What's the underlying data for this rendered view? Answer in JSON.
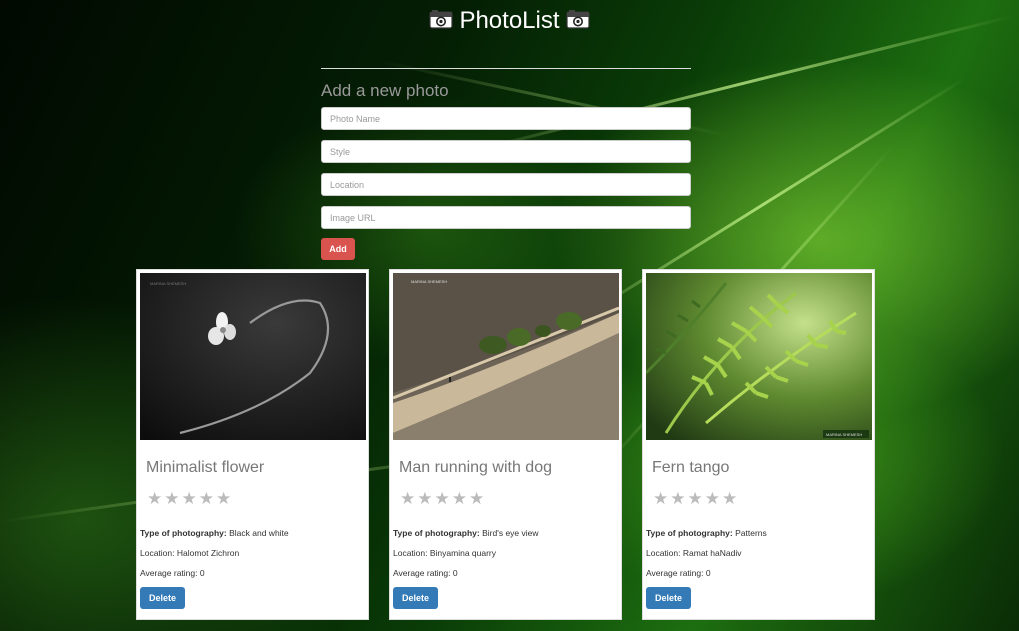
{
  "header": {
    "title": "PhotoList",
    "icon": "camera-icon"
  },
  "form": {
    "heading": "Add a new photo",
    "name_placeholder": "Photo Name",
    "style_placeholder": "Style",
    "location_placeholder": "Location",
    "url_placeholder": "Image URL",
    "add_label": "Add"
  },
  "cards": [
    {
      "name": "Minimalist flower",
      "type_label": "Type of photography:",
      "type": "Black and white",
      "location_label": "Location:",
      "location": "Halomot Zichron",
      "rating_label": "Average rating:",
      "rating": "0",
      "stars_filled": 0,
      "stars_total": 5,
      "delete_label": "Delete",
      "watermark": "MARINA SHEMESH"
    },
    {
      "name": "Man running with dog",
      "type_label": "Type of photography:",
      "type": "Bird's eye view",
      "location_label": "Location:",
      "location": "Binyamina quarry",
      "rating_label": "Average rating:",
      "rating": "0",
      "stars_filled": 0,
      "stars_total": 5,
      "delete_label": "Delete",
      "watermark": "MARINA SHEMESH"
    },
    {
      "name": "Fern tango",
      "type_label": "Type of photography:",
      "type": "Patterns",
      "location_label": "Location:",
      "location": "Ramat haNadiv",
      "rating_label": "Average rating:",
      "rating": "0",
      "stars_filled": 0,
      "stars_total": 5,
      "delete_label": "Delete",
      "watermark": "MARINA SHEMESH"
    }
  ],
  "colors": {
    "add_button": "#d9534f",
    "delete_button": "#337ab7"
  }
}
